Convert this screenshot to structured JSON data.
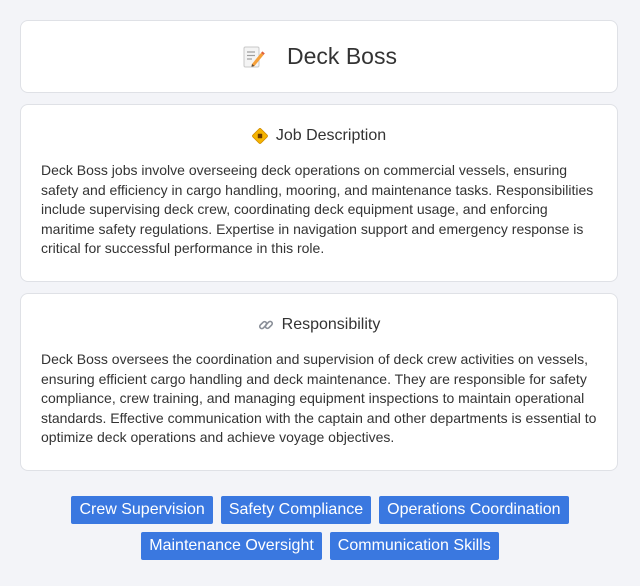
{
  "header": {
    "title": "Deck Boss",
    "icon": "memo-pencil-icon"
  },
  "job_description": {
    "heading": "Job Description",
    "icon": "diamond-sign-icon",
    "text": "Deck Boss jobs involve overseeing deck operations on commercial vessels, ensuring safety and efficiency in cargo handling, mooring, and maintenance tasks. Responsibilities include supervising deck crew, coordinating deck equipment usage, and enforcing maritime safety regulations. Expertise in navigation support and emergency response is critical for successful performance in this role."
  },
  "responsibility": {
    "heading": "Responsibility",
    "icon": "link-icon",
    "text": "Deck Boss oversees the coordination and supervision of deck crew activities on vessels, ensuring efficient cargo handling and deck maintenance. They are responsible for safety compliance, crew training, and managing equipment inspections to maintain operational standards. Effective communication with the captain and other departments is essential to optimize deck operations and achieve voyage objectives."
  },
  "tags": [
    "Crew Supervision",
    "Safety Compliance",
    "Operations Coordination",
    "Maintenance Oversight",
    "Communication Skills"
  ],
  "colors": {
    "tag_bg": "#3a78e0",
    "page_bg": "#f3f4f8"
  }
}
